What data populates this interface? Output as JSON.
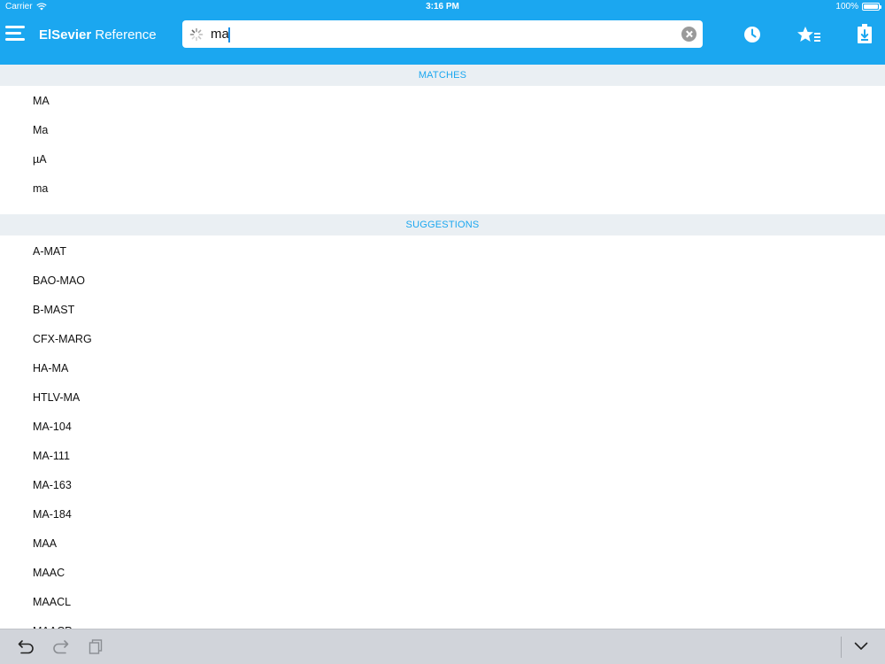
{
  "status_bar": {
    "carrier": "Carrier",
    "time": "3:16 PM",
    "battery": "100%"
  },
  "header": {
    "title_brand": "ElSevier",
    "title_rest": " Reference",
    "search": {
      "value": "ma",
      "placeholder": ""
    }
  },
  "sections": {
    "matches": {
      "title": "MATCHES",
      "items": [
        "MA",
        "Ma",
        "µA",
        "ma"
      ]
    },
    "suggestions": {
      "title": "SUGGESTIONS",
      "items": [
        "A-MAT",
        "BAO-MAO",
        "B-MAST",
        "CFX-MARG",
        "HA-MA",
        "HTLV-MA",
        "MA-104",
        "MA-111",
        "MA-163",
        "MA-184",
        "MAA",
        "MAAC",
        "MAACL",
        "MAACP"
      ]
    }
  },
  "colors": {
    "accent": "#1ba7f0",
    "section_bg": "#eaeff3",
    "toolbar_bg": "#d1d4da"
  },
  "icons": {
    "menu": "hamburger-menu-icon",
    "history": "clock-icon",
    "favorites": "star-list-icon",
    "downloads": "download-icon",
    "clear": "clear-icon",
    "spinner": "loading-spinner-icon",
    "undo": "undo-icon",
    "redo": "redo-icon",
    "paste": "paste-icon",
    "dismiss": "chevron-down-icon"
  }
}
